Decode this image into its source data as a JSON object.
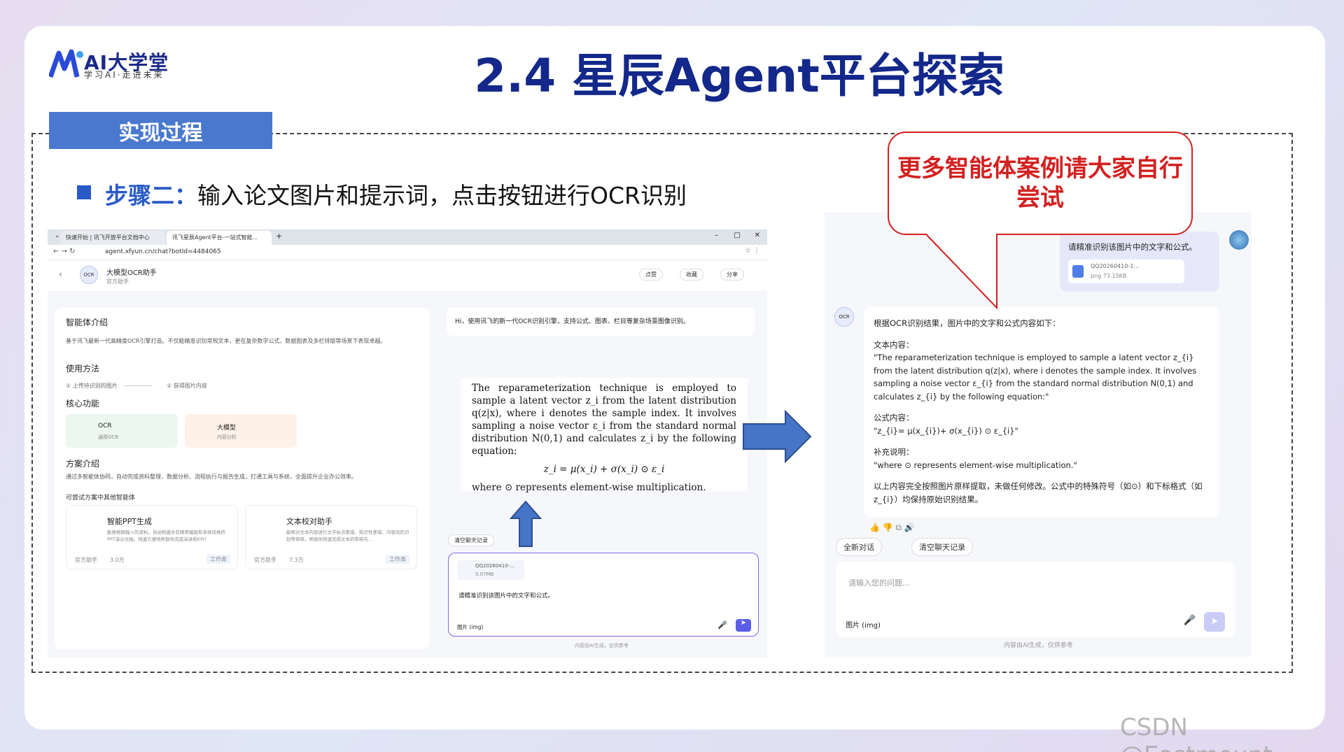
{
  "slide": {
    "logo_main": "AI大学堂",
    "logo_sub": "学习AI·走进未来",
    "title": "2.4 星辰Agent平台探索",
    "section_tab": "实现过程",
    "step_label": "步骤二：",
    "step_text": "输入论文图片和提示词，点击按钮进行OCR识别",
    "callout": "更多智能体案例请大家自行尝试",
    "watermark": "CSDN @Eastmount"
  },
  "colors": {
    "title": "#13288a",
    "tab": "#4a78cf",
    "accent": "#2a5ac8",
    "callout": "#d42020"
  },
  "left_screenshot": {
    "browser_tabs": [
      "快速开始 | 讯飞开放平台文档中心",
      "讯飞星辰Agent平台-一站式智能..."
    ],
    "url": "agent.xfyun.cn/chat?botId=4484065",
    "agent_name": "大模型OCR助手",
    "agent_sub": "官方助手",
    "actions": [
      "点赞",
      "收藏",
      "分享"
    ],
    "intro_title": "智能体介绍",
    "intro_text": "基于讯飞最新一代高精度OCR引擎打造。不仅能精准识别常规文本，更在复杂数学公式、数据图表及多栏排版等场景下表现卓越。",
    "usage_title": "使用方法",
    "usage_steps": [
      "上传待识别的图片",
      "获得图片内容"
    ],
    "core_title": "核心功能",
    "features": [
      {
        "name": "OCR",
        "sub": "通用OCR"
      },
      {
        "name": "大模型",
        "sub": "内容分析"
      }
    ],
    "plan_title": "方案介绍",
    "plan_text": "通过多智能体协同，自动完成资料整理、数据分析、流程执行与报告生成，打通工具与系统，全面提升企业办公效率。",
    "others_title": "可尝试方案中其他智能体",
    "others": [
      {
        "name": "智能PPT生成",
        "desc": "能够根据输入的资料，自动构建含有精美模版和多样风格的PPT演示文稿，快速方便地帮助你完成演讲和KPI！",
        "meta": "官方助手",
        "count": "3.0万",
        "tag": "工作类"
      },
      {
        "name": "文本校对助手",
        "desc": "能够对文本内容进行文字标点差错、知识性差错、内容风险识别等审核，帮助你快速完成文本的审核与...",
        "meta": "官方助手",
        "count": "7.3万",
        "tag": "工作类"
      }
    ],
    "greeting": "Hi，使用讯飞的新一代OCR识别引擎，支持公式、图表、栏目等复杂场景图像识别。",
    "paper_text": "The reparameterization technique is employed to sample a latent vector z_i from the latent distribution q(z|x), where i denotes the sample index. It involves sampling a noise vector ε_i from the standard normal distribution N(0,1) and calculates z_i by the following equation:",
    "paper_eq": "z_i = μ(x_i) + σ(x_i) ⊙ ε_i",
    "paper_where": "where ⊙ represents element-wise multiplication.",
    "clear_btn": "清空聊天记录",
    "file_name": "QQ20260410-...",
    "file_size": "0.07MB",
    "input_text": "请精准识别该图片中的文字和公式。",
    "img_btn": "图片 (img)",
    "footer": "内容由AI生成，仅供参考"
  },
  "right_screenshot": {
    "user_msg": "请精准识别该图片中的文字和公式。",
    "file_name": "QQ20260410-1...",
    "file_meta": "png 73.15KB",
    "reply_intro": "根据OCR识别结果，图片中的文字和公式内容如下：",
    "text_label": "文本内容：",
    "text_body": "\"The reparameterization technique is employed to sample a latent vector z_{i} from the latent distribution q(z|x), where i denotes the sample index. It involves sampling a noise vector ε_{i} from the standard normal distribution N(0,1) and calculates z_{i} by the following equation:\"",
    "formula_label": "公式内容：",
    "formula_body": "\"z_{i}= μ(x_{i})+ σ(x_{i}) ⊙ ε_{i}\"",
    "note_label": "补充说明：",
    "note_body": "\"where ⊙ represents element-wise multiplication.\"",
    "summary": "以上内容完全按照图片原样提取，未做任何修改。公式中的特殊符号（如⊙）和下标格式（如z_{i}）均保持原始识别结果。",
    "new_chat": "全新对话",
    "clear_btn": "清空聊天记录",
    "placeholder": "请输入您的问题...",
    "img_btn": "图片 (img)",
    "footer": "内容由AI生成，仅供参考"
  }
}
